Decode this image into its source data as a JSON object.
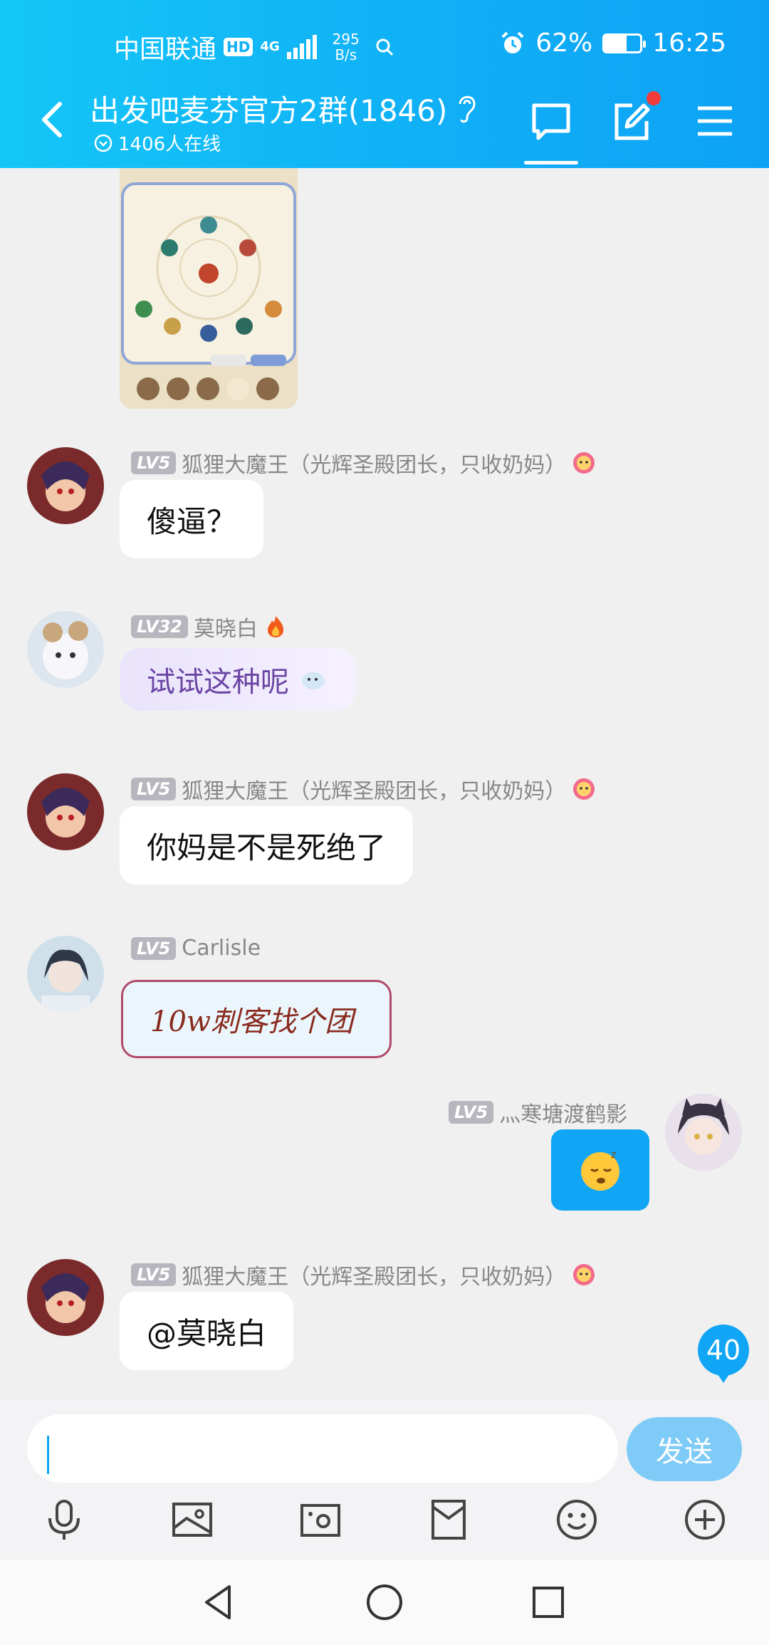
{
  "status": {
    "carrier": "中国联通",
    "hd": "HD",
    "network": "4G",
    "speed_value": "295",
    "speed_unit": "B/s",
    "battery": "62%",
    "battery_level": 0.62,
    "time": "16:25"
  },
  "header": {
    "title": "出发吧麦芬官方2群(1846)",
    "online": "1406人在线",
    "accent": "#10b0f6"
  },
  "messages": [
    {
      "level": "LV5",
      "name": "狐狸大魔王（光辉圣殿团长，只收奶妈）",
      "text": "傻逼？"
    },
    {
      "level": "LV32",
      "name": "莫晓白",
      "text": "试试这种呢"
    },
    {
      "level": "LV5",
      "name": "狐狸大魔王（光辉圣殿团长，只收奶妈）",
      "text": "你妈是不是死绝了"
    },
    {
      "level": "LV5",
      "name": "Carlisle",
      "text": "10w刺客找个团"
    },
    {
      "level": "LV5",
      "name": "灬寒塘渡鹤影",
      "text": ""
    },
    {
      "level": "LV5",
      "name": "狐狸大魔王（光辉圣殿团长，只收奶妈）",
      "text": "@莫晓白"
    }
  ],
  "unread": "40",
  "input": {
    "placeholder": "",
    "send_label": "发送"
  },
  "icons": [
    "back-arrow-icon",
    "ear-icon",
    "chat-icon",
    "edit-icon",
    "menu-icon",
    "microphone-icon",
    "image-icon",
    "camera-icon",
    "red-packet-icon",
    "emoji-icon",
    "plus-icon"
  ]
}
